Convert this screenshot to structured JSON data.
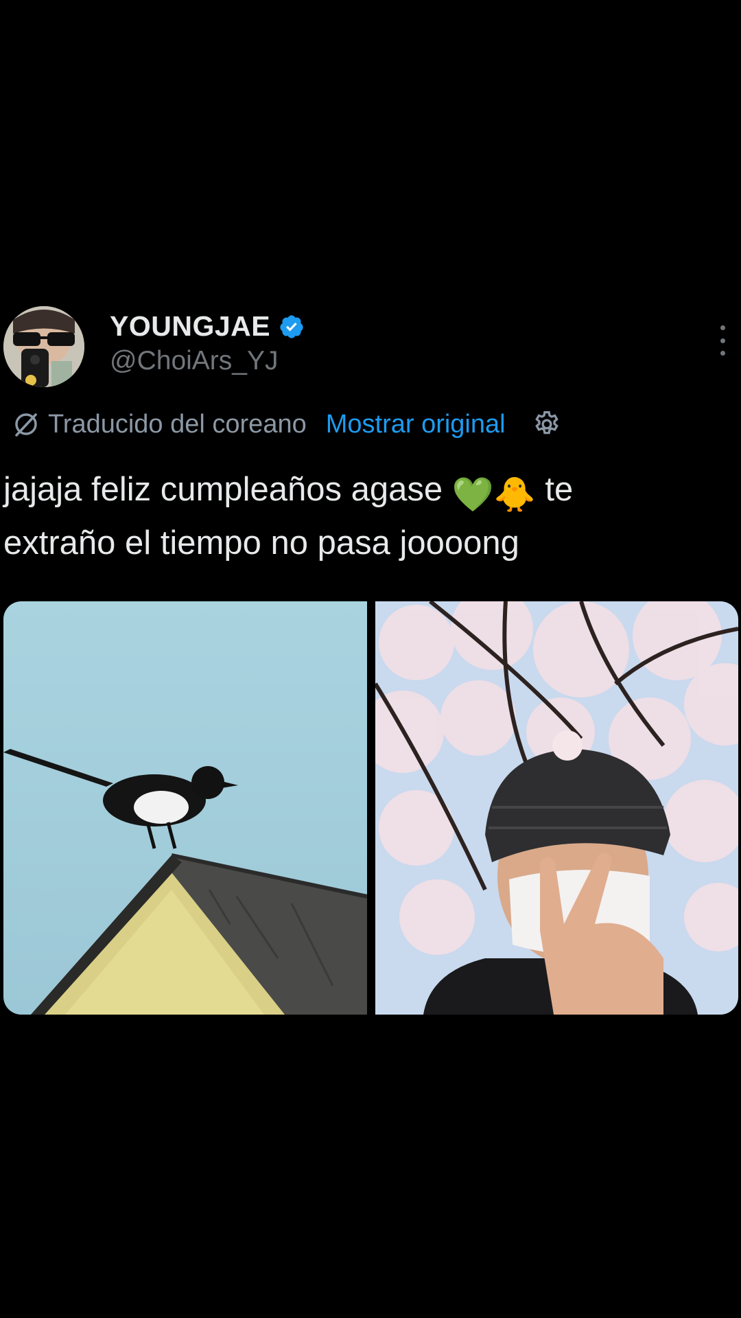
{
  "author": {
    "display_name": "YOUNGJAE",
    "handle": "@ChoiArs_YJ",
    "verified": true,
    "avatar_icon": "avatar-photo"
  },
  "translation": {
    "label": "Traducido del coreano",
    "show_original": "Mostrar original",
    "icon": "translate-icon",
    "settings_icon": "gear-icon"
  },
  "tweet": {
    "text_line1": "jajaja feliz cumpleaños agase ",
    "emoji1": "💚",
    "emoji2": "🐥",
    "text_line1_end": " te",
    "text_line2": "extraño el tiempo no pasa joooong"
  },
  "media": [
    {
      "name": "photo-magpie-on-roof",
      "description_icon": "image"
    },
    {
      "name": "photo-selfie-cherry-blossoms",
      "description_icon": "image"
    }
  ],
  "colors": {
    "background": "#000000",
    "text": "#e7e9ea",
    "muted": "#71767b",
    "link": "#1d9bf0",
    "verified": "#1d9bf0"
  }
}
